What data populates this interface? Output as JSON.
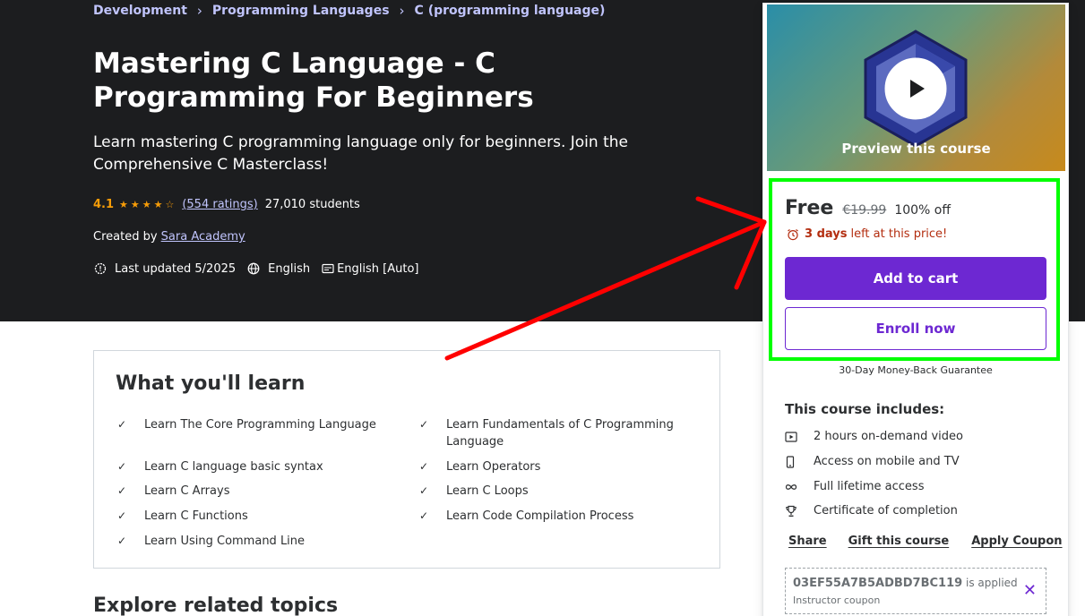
{
  "breadcrumb": [
    "Development",
    "Programming Languages",
    "C (programming language)"
  ],
  "course": {
    "title": "Mastering C Language - C Programming For Beginners",
    "subtitle": "Learn mastering C programming language only for beginners. Join the Comprehensive C Masterclass!",
    "rating": "4.1",
    "stars": 4.1,
    "ratings_count": "(554 ratings)",
    "students": "27,010 students",
    "created_by_label": "Created by",
    "instructor": "Sara Academy",
    "last_updated": "Last updated 5/2025",
    "language": "English",
    "captions": "English [Auto]"
  },
  "learn": {
    "title": "What you'll learn",
    "items": [
      "Learn The Core Programming Language",
      "Learn Fundamentals of C Programming Language",
      "Learn C language basic syntax",
      "Learn Operators",
      "Learn C Arrays",
      "Learn C Loops",
      "Learn C Functions",
      "Learn Code Compilation Process",
      "Learn Using Command Line"
    ]
  },
  "explore_title": "Explore related topics",
  "sidebar": {
    "preview_label": "Preview this course",
    "price": "Free",
    "original_price": "€19.99",
    "discount": "100% off",
    "timer_bold": "3 days",
    "timer_rest": "left at this price!",
    "add_to_cart": "Add to cart",
    "enroll_now": "Enroll now",
    "guarantee": "30-Day Money-Back Guarantee",
    "includes_title": "This course includes:",
    "includes": [
      {
        "icon": "video-icon",
        "label": "2 hours on-demand video"
      },
      {
        "icon": "mobile-icon",
        "label": "Access on mobile and TV"
      },
      {
        "icon": "infinity-icon",
        "label": "Full lifetime access"
      },
      {
        "icon": "trophy-icon",
        "label": "Certificate of completion"
      }
    ],
    "share": "Share",
    "gift": "Gift this course",
    "apply_coupon": "Apply Coupon",
    "coupon_code": "03EF55A7B5ADBD7BC119",
    "coupon_applied": "is applied",
    "coupon_type": "Instructor coupon"
  },
  "colors": {
    "hero_bg": "#1c1d1f",
    "link": "#c0c4fc",
    "star": "#f69c08",
    "primary": "#6d28d2",
    "timer": "#b32d0f",
    "annotation_box": "#00ff00",
    "annotation_arrow": "#ff0000"
  }
}
